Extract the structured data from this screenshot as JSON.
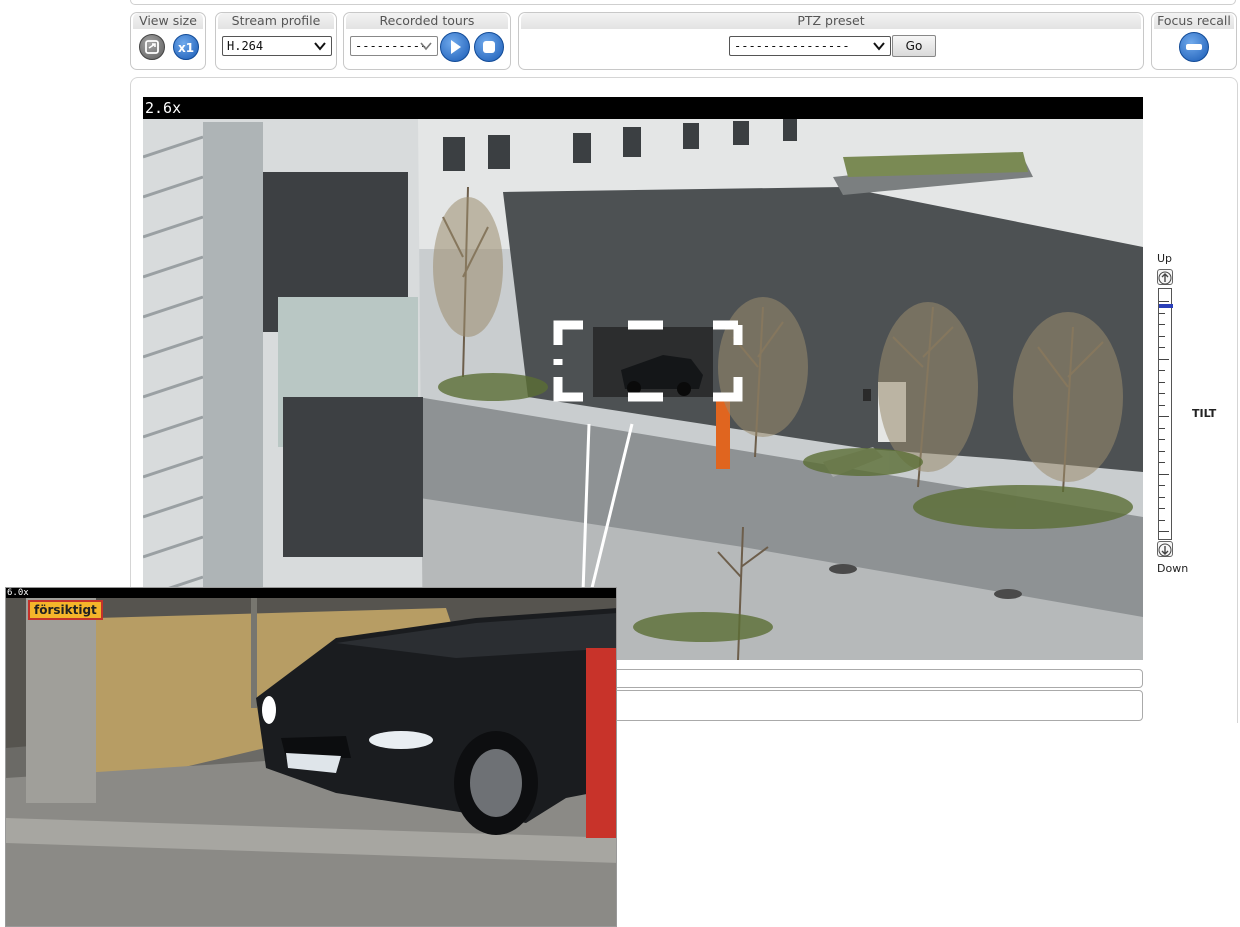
{
  "toolbar": {
    "view_size": {
      "title": "View size"
    },
    "stream_profile": {
      "title": "Stream profile",
      "selected": "H.264"
    },
    "recorded_tours": {
      "title": "Recorded tours",
      "selected": "----------"
    },
    "ptz_preset": {
      "title": "PTZ preset",
      "selected": "----------------",
      "go_label": "Go"
    },
    "focus_recall": {
      "title": "Focus recall"
    }
  },
  "video": {
    "zoom_label": "2.6x"
  },
  "tilt": {
    "up_label": "Up",
    "down_label": "Down",
    "axis_label": "TILT",
    "level": 0.06
  },
  "inset": {
    "zoom_label": "6.0x",
    "sign_text": "försiktigt"
  },
  "colors": {
    "accent_blue": "#1a5bb5",
    "tilt_marker": "#2a3fb8",
    "video_bar": "#000000"
  }
}
